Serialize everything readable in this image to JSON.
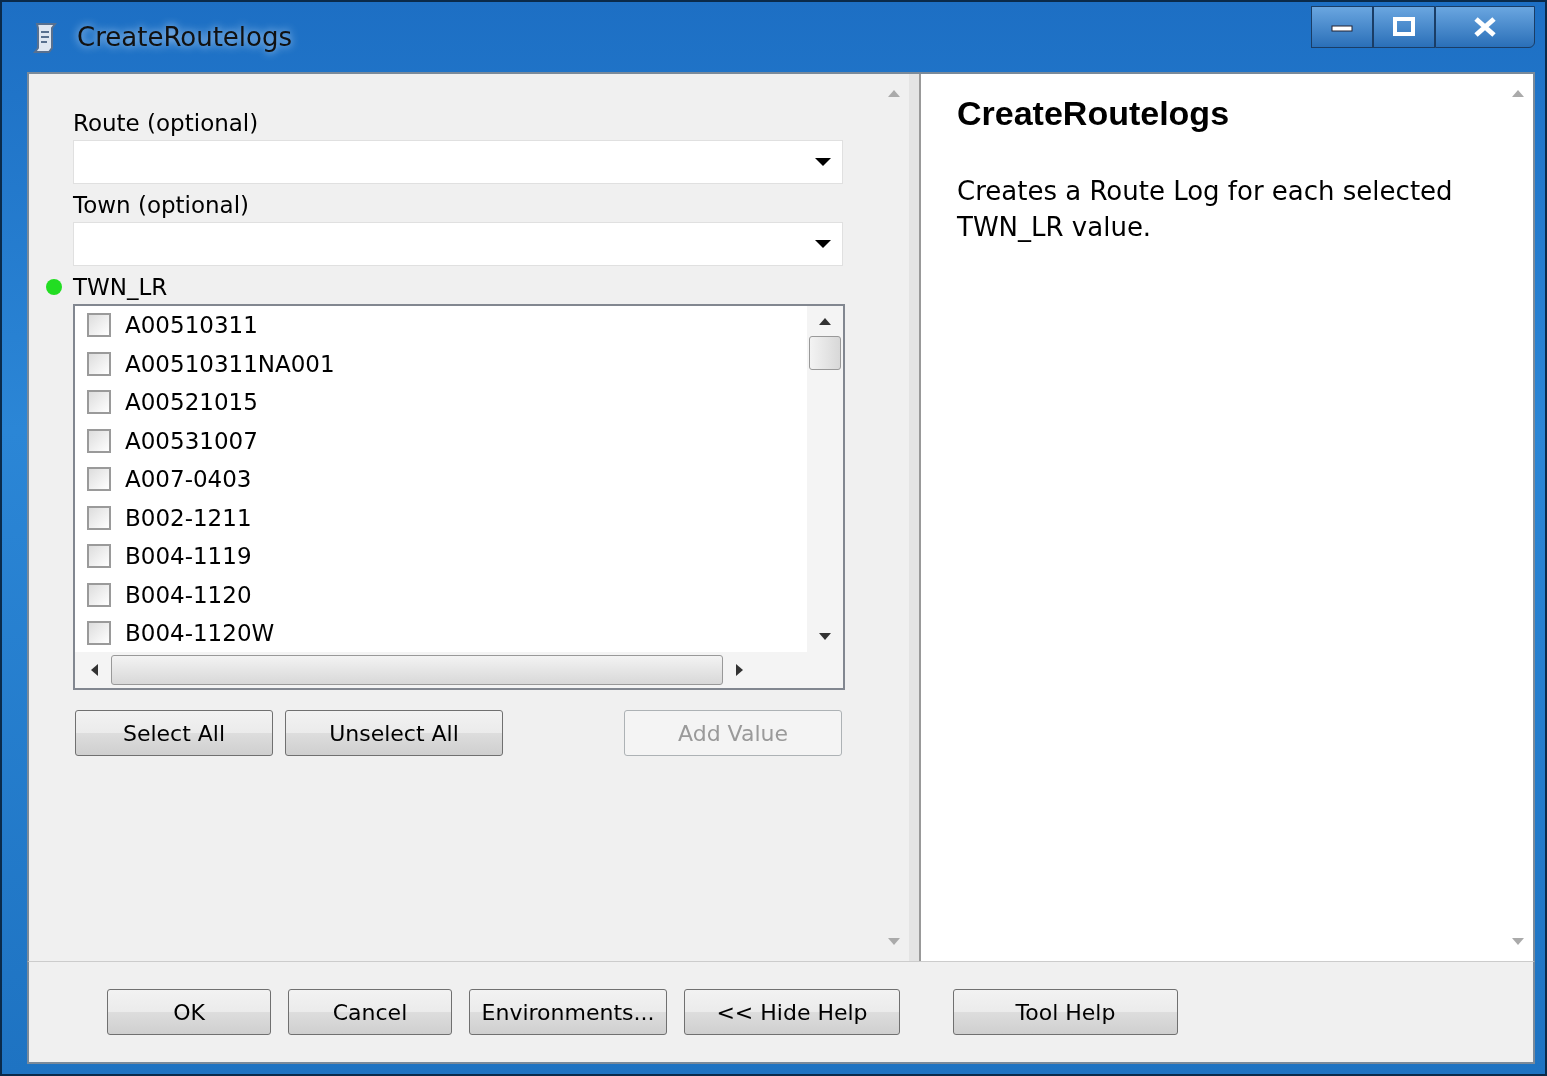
{
  "window": {
    "title": "CreateRoutelogs"
  },
  "parameters": [
    {
      "kind": "dropdown",
      "label": "Route (optional)",
      "required": false
    },
    {
      "kind": "dropdown",
      "label": "Town (optional)",
      "required": false
    },
    {
      "kind": "checklist",
      "label": "TWN_LR",
      "required": true,
      "items": [
        {
          "label": "A00510311",
          "checked": false
        },
        {
          "label": "A00510311NA001",
          "checked": false
        },
        {
          "label": "A00521015",
          "checked": false
        },
        {
          "label": "A00531007",
          "checked": false
        },
        {
          "label": "A007-0403",
          "checked": false
        },
        {
          "label": "B002-1211",
          "checked": false
        },
        {
          "label": "B004-1119",
          "checked": false
        },
        {
          "label": "B004-1120",
          "checked": false
        },
        {
          "label": "B004-1120W",
          "checked": false
        }
      ],
      "buttons": [
        {
          "label": "Select All",
          "disabled": false
        },
        {
          "label": "Unselect All",
          "disabled": false
        },
        {
          "label": "Add Value",
          "disabled": true
        }
      ]
    }
  ],
  "help": {
    "title": "CreateRoutelogs",
    "text": "Creates a Route Log for each selected TWN_LR value."
  },
  "footer_buttons": [
    {
      "label": "OK"
    },
    {
      "label": "Cancel"
    },
    {
      "label": "Environments..."
    },
    {
      "label": "<< Hide Help"
    },
    {
      "label": "Tool Help"
    }
  ]
}
